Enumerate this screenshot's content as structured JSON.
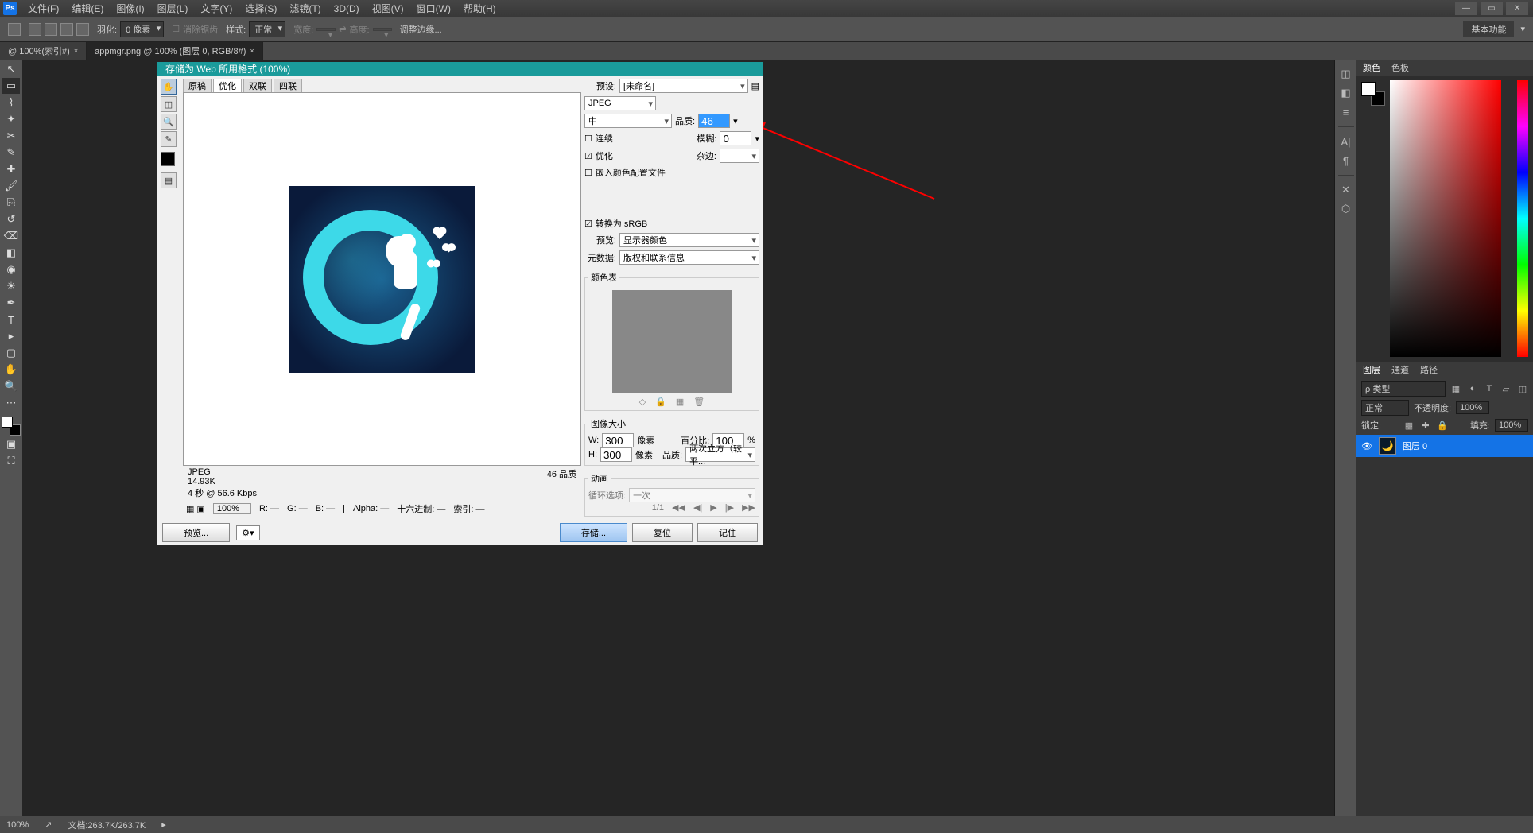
{
  "menu": [
    "文件(F)",
    "编辑(E)",
    "图像(I)",
    "图层(L)",
    "文字(Y)",
    "选择(S)",
    "滤镜(T)",
    "3D(D)",
    "视图(V)",
    "窗口(W)",
    "帮助(H)"
  ],
  "options": {
    "feather_label": "羽化:",
    "feather_value": "0 像素",
    "antialias": "消除锯齿",
    "style_label": "样式:",
    "style_value": "正常",
    "width_label": "宽度:",
    "height_label": "高度:",
    "refine_edge": "调整边缘...",
    "basic_function": "基本功能"
  },
  "tabs": [
    {
      "label": "@ 100%(索引#)"
    },
    {
      "label": "appmgr.png @ 100% (图层 0, RGB/8#)"
    }
  ],
  "statusbar": {
    "zoom": "100%",
    "doc": "文档:263.7K/263.7K"
  },
  "sfw": {
    "title": "存储为 Web 所用格式 (100%)",
    "tabs": [
      "原稿",
      "优化",
      "双联",
      "四联"
    ],
    "info_format": "JPEG",
    "info_size": "14.93K",
    "info_time": "4 秒 @ 56.6 Kbps",
    "quality_display": "46 品质",
    "zoom": "100%",
    "readout_r": "R: —",
    "readout_g": "G: —",
    "readout_b": "B: —",
    "readout_alpha": "Alpha: —",
    "readout_hex": "十六进制: —",
    "readout_index": "索引: —",
    "preset_label": "预设:",
    "preset_value": "[未命名]",
    "format": "JPEG",
    "compression": "中",
    "quality_label": "品质:",
    "quality_value": "46",
    "progressive": "连续",
    "optimized": "优化",
    "embed_profile": "嵌入颜色配置文件",
    "blur_label": "模糊:",
    "blur_value": "0",
    "matte_label": "杂边:",
    "convert_srgb": "转换为 sRGB",
    "preview_label": "预览:",
    "preview_value": "显示器颜色",
    "metadata_label": "元数据:",
    "metadata_value": "版权和联系信息",
    "color_table_label": "颜色表",
    "image_size_label": "图像大小",
    "w_label": "W:",
    "w_value": "300",
    "h_label": "H:",
    "h_value": "300",
    "px": "像素",
    "percent_label": "百分比:",
    "percent_value": "100",
    "percent_sign": "%",
    "quality2_label": "品质:",
    "quality2_value": "两次立方（较平...",
    "animation_label": "动画",
    "loop_label": "循环选项:",
    "loop_value": "一次",
    "frame": "1/1",
    "btn_preview": "预览...",
    "btn_save": "存储...",
    "btn_cancel": "复位",
    "btn_remember": "记住"
  },
  "panels": {
    "color_tab": "颜色",
    "swatches_tab": "色板",
    "layers_tab": "图层",
    "channels_tab": "通道",
    "paths_tab": "路径",
    "kind_label": "ρ 类型",
    "blend_mode": "正常",
    "opacity_label": "不透明度:",
    "opacity_value": "100%",
    "lock_label": "锁定:",
    "fill_label": "填充:",
    "fill_value": "100%",
    "layer_name": "图层 0"
  }
}
